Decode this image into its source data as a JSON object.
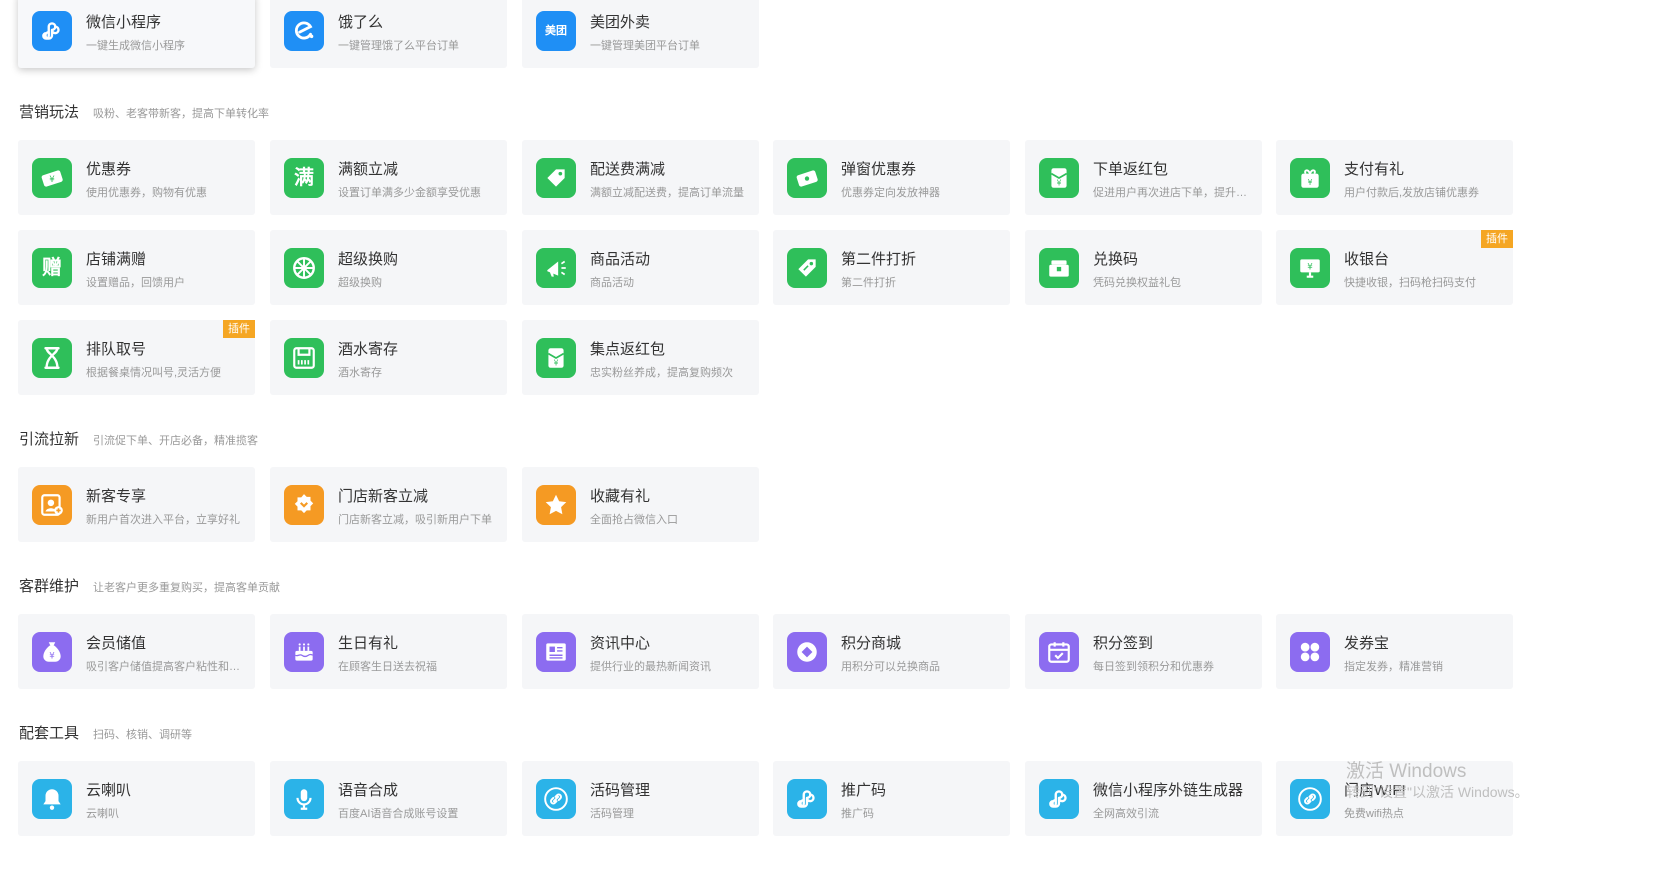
{
  "colors": {
    "blue": "#1f8ff5",
    "green": "#2fbf5a",
    "orange": "#f59a23",
    "purple": "#8c6cf0",
    "cyan": "#2bb3e8",
    "badge": "#f5a623"
  },
  "sections": [
    {
      "id": "platform",
      "title": "",
      "desc": "",
      "cards": [
        {
          "title": "微信小程序",
          "sub": "一键生成微信小程序",
          "icon": "mini-program-icon",
          "color": "#1f8ff5"
        },
        {
          "title": "饿了么",
          "sub": "一键管理饿了么平台订单",
          "icon": "eleme-icon",
          "color": "#1f8ff5"
        },
        {
          "title": "美团外卖",
          "sub": "一键管理美团平台订单",
          "icon": "meituan-icon",
          "color": "#1f8ff5",
          "glyph": "美团"
        }
      ]
    },
    {
      "id": "marketing",
      "title": "营销玩法",
      "desc": "吸粉、老客带新客，提高下单转化率",
      "cards": [
        {
          "title": "优惠券",
          "sub": "使用优惠券，购物有优惠",
          "icon": "coupon-icon",
          "color": "#2fbf5a"
        },
        {
          "title": "满额立减",
          "sub": "设置订单满多少金额享受优惠",
          "icon": "full-reduction-icon",
          "color": "#2fbf5a",
          "glyph": "满"
        },
        {
          "title": "配送费满减",
          "sub": "满额立减配送费，提高订单流量",
          "icon": "delivery-fee-tag-icon",
          "color": "#2fbf5a"
        },
        {
          "title": "弹窗优惠券",
          "sub": "优惠券定向发放神器",
          "icon": "popup-coupon-icon",
          "color": "#2fbf5a"
        },
        {
          "title": "下单返红包",
          "sub": "促进用户再次进店下单，提升复购率",
          "icon": "red-packet-icon",
          "color": "#2fbf5a"
        },
        {
          "title": "支付有礼",
          "sub": "用户付款后,发放店铺优惠券",
          "icon": "pay-gift-icon",
          "color": "#2fbf5a"
        },
        {
          "title": "店铺满赠",
          "sub": "设置赠品，回馈用户",
          "icon": "gift-char-icon",
          "color": "#2fbf5a",
          "glyph": "赠"
        },
        {
          "title": "超级换购",
          "sub": "超级换购",
          "icon": "swap-wheel-icon",
          "color": "#2fbf5a"
        },
        {
          "title": "商品活动",
          "sub": "商品活动",
          "icon": "megaphone-icon",
          "color": "#2fbf5a"
        },
        {
          "title": "第二件打折",
          "sub": "第二件打折",
          "icon": "discount-tag-icon",
          "color": "#2fbf5a"
        },
        {
          "title": "兑换码",
          "sub": "凭码兑换权益礼包",
          "icon": "redeem-code-icon",
          "color": "#2fbf5a"
        },
        {
          "title": "收银台",
          "sub": "快捷收银，扫码枪扫码支付",
          "icon": "cashier-icon",
          "color": "#2fbf5a",
          "badge": "插件"
        },
        {
          "title": "排队取号",
          "sub": "根据餐桌情况叫号,灵活方便",
          "icon": "hourglass-icon",
          "color": "#2fbf5a",
          "badge": "插件"
        },
        {
          "title": "酒水寄存",
          "sub": "酒水寄存",
          "icon": "storage-icon",
          "color": "#2fbf5a"
        },
        {
          "title": "集点返红包",
          "sub": "忠实粉丝养成，提高复购频次",
          "icon": "points-red-packet-icon",
          "color": "#2fbf5a"
        }
      ]
    },
    {
      "id": "acquisition",
      "title": "引流拉新",
      "desc": "引流促下单、开店必备，精准揽客",
      "cards": [
        {
          "title": "新客专享",
          "sub": "新用户首次进入平台，立享好礼",
          "icon": "new-customer-icon",
          "color": "#f59a23"
        },
        {
          "title": "门店新客立减",
          "sub": "门店新客立减，吸引新用户下单",
          "icon": "store-new-customer-icon",
          "color": "#f59a23"
        },
        {
          "title": "收藏有礼",
          "sub": "全面抢占微信入口",
          "icon": "star-icon",
          "color": "#f59a23"
        }
      ]
    },
    {
      "id": "retention",
      "title": "客群维护",
      "desc": "让老客户更多重复购买，提高客单贡献",
      "cards": [
        {
          "title": "会员储值",
          "sub": "吸引客户储值提高客户粘性和复购",
          "icon": "money-bag-icon",
          "color": "#8c6cf0"
        },
        {
          "title": "生日有礼",
          "sub": "在顾客生日送去祝福",
          "icon": "birthday-cake-icon",
          "color": "#8c6cf0"
        },
        {
          "title": "资讯中心",
          "sub": "提供行业的最热新闻资讯",
          "icon": "news-icon",
          "color": "#8c6cf0"
        },
        {
          "title": "积分商城",
          "sub": "用积分可以兑换商品",
          "icon": "points-mall-icon",
          "color": "#8c6cf0"
        },
        {
          "title": "积分签到",
          "sub": "每日签到领积分和优惠券",
          "icon": "calendar-check-icon",
          "color": "#8c6cf0"
        },
        {
          "title": "发券宝",
          "sub": "指定发券，精准营销",
          "icon": "grid-apps-icon",
          "color": "#8c6cf0"
        }
      ]
    },
    {
      "id": "tools",
      "title": "配套工具",
      "desc": "扫码、核销、调研等",
      "cards": [
        {
          "title": "云喇叭",
          "sub": "云喇叭",
          "icon": "bell-icon",
          "color": "#2bb3e8"
        },
        {
          "title": "语音合成",
          "sub": "百度AI语音合成账号设置",
          "icon": "microphone-icon",
          "color": "#2bb3e8"
        },
        {
          "title": "活码管理",
          "sub": "活码管理",
          "icon": "link-icon",
          "color": "#2bb3e8"
        },
        {
          "title": "推广码",
          "sub": "推广码",
          "icon": "mini-program-icon",
          "color": "#2bb3e8"
        },
        {
          "title": "微信小程序外链生成器",
          "sub": "全网高效引流",
          "icon": "mini-program-icon",
          "color": "#2bb3e8"
        },
        {
          "title": "门店WIFI",
          "sub": "免费wifi热点",
          "icon": "link-icon",
          "color": "#2bb3e8"
        }
      ]
    }
  ],
  "watermark": {
    "line1": "激活 Windows",
    "line2": "转到\"设置\"以激活 Windows。"
  }
}
